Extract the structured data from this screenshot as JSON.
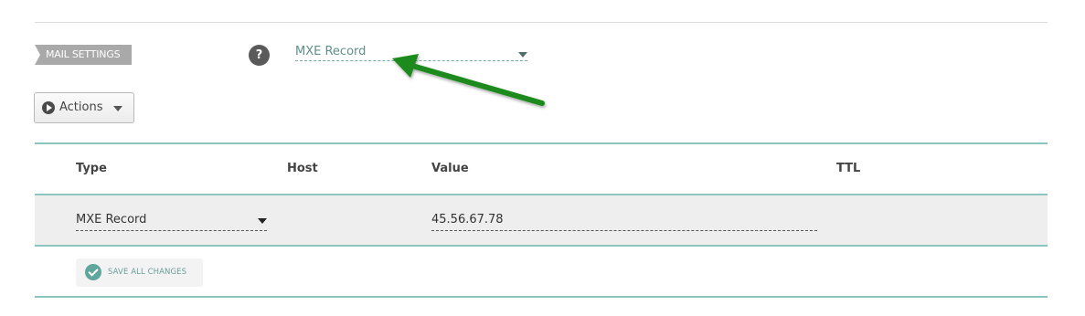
{
  "mail_settings": {
    "label": "MAIL SETTINGS",
    "help_icon": "?",
    "selected": "MXE Record"
  },
  "actions": {
    "label": "Actions"
  },
  "table": {
    "columns": [
      "Type",
      "Host",
      "Value",
      "TTL"
    ],
    "rows": [
      {
        "type": "MXE Record",
        "host": "",
        "value": "45.56.67.78",
        "ttl": ""
      }
    ]
  },
  "save_button": {
    "label": "SAVE ALL CHANGES"
  },
  "colors": {
    "accent_teal": "#8cc5bd",
    "arrow_green": "#1e8a1e",
    "tag_gray": "#a9a9a9"
  },
  "icons": {
    "help": "question-mark-icon",
    "actions": "play-circle-icon",
    "dropdown": "caret-down-icon",
    "save": "check-circle-icon",
    "annotation": "green-arrow-icon"
  }
}
